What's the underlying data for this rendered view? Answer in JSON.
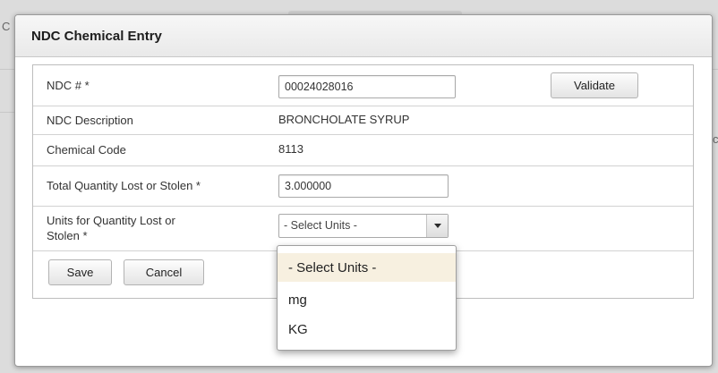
{
  "dialog": {
    "title": "NDC Chemical Entry"
  },
  "fields": {
    "ndc": {
      "label": "NDC # *",
      "value": "00024028016",
      "validate_label": "Validate"
    },
    "description": {
      "label": "NDC Description",
      "value": "BRONCHOLATE SYRUP"
    },
    "chemical_code": {
      "label": "Chemical Code",
      "value": "8113"
    },
    "quantity": {
      "label": "Total Quantity Lost or Stolen *",
      "value": "3.000000"
    },
    "units": {
      "label_line1": "Units for Quantity Lost or",
      "label_line2": "Stolen *",
      "selected": "- Select Units -",
      "options": [
        "- Select Units -",
        "mg",
        "KG"
      ]
    }
  },
  "actions": {
    "save_label": "Save",
    "cancel_label": "Cancel"
  },
  "icons": {
    "dropdown_arrow": "chevron-down-icon"
  }
}
